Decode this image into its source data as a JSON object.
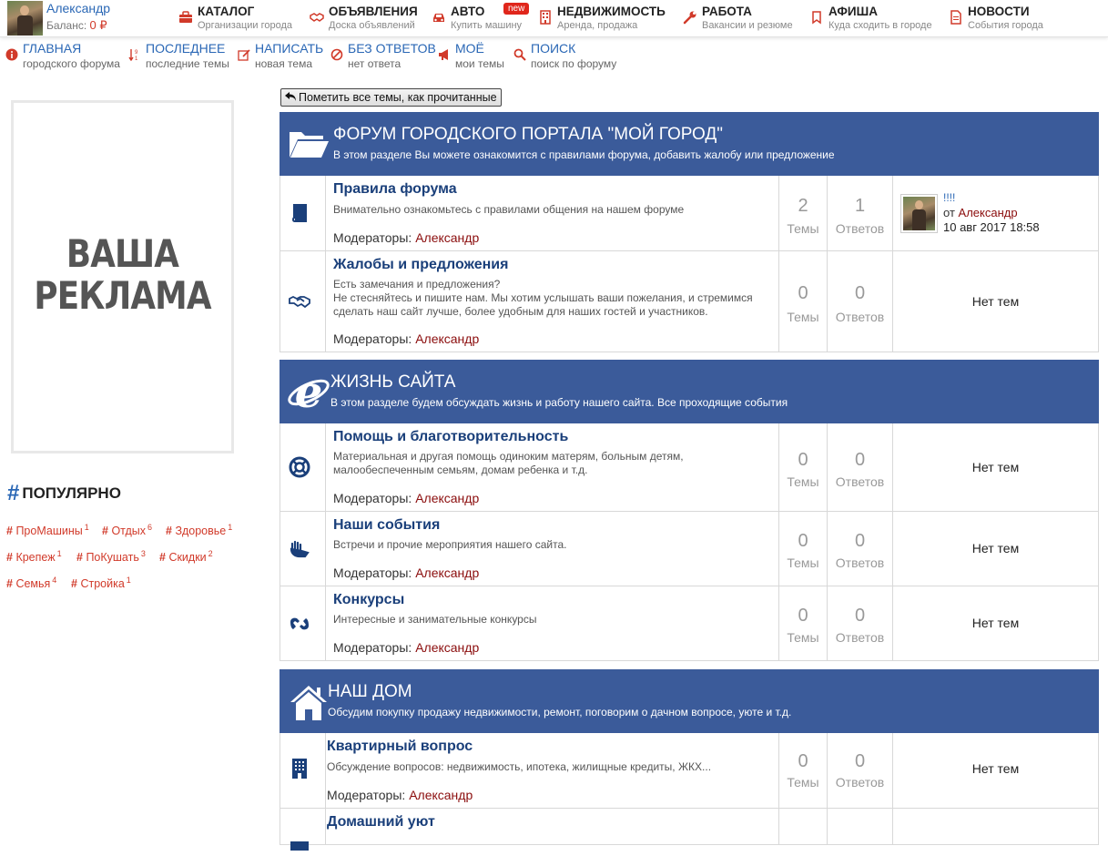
{
  "user": {
    "name": "Александр",
    "balance_label": "Баланс:",
    "balance_value": "0 ₽"
  },
  "mainnav": [
    {
      "title": "КАТАЛОГ",
      "sub": "Организации города",
      "icon": "briefcase-icon"
    },
    {
      "title": "ОБЪЯВЛЕНИЯ",
      "sub": "Доска объявлений",
      "icon": "handshake-icon"
    },
    {
      "title": "АВТО",
      "sub": "Купить машину",
      "icon": "car-icon",
      "badge": "new"
    },
    {
      "title": "НЕДВИЖИМОСТЬ",
      "sub": "Аренда, продажа",
      "icon": "building-icon"
    },
    {
      "title": "РАБОТА",
      "sub": "Вакансии и резюме",
      "icon": "wrench-icon"
    },
    {
      "title": "АФИША",
      "sub": "Куда сходить в городе",
      "icon": "bookmark-icon"
    },
    {
      "title": "НОВОСТИ",
      "sub": "События города",
      "icon": "document-icon"
    }
  ],
  "forumnav": [
    {
      "title": "Главная",
      "sub": "городского форума",
      "icon": "info-icon"
    },
    {
      "title": "Последнее",
      "sub": "последние темы",
      "icon": "sort-icon"
    },
    {
      "title": "Написать",
      "sub": "новая тема",
      "icon": "edit-icon"
    },
    {
      "title": "Без ответов",
      "sub": "нет ответа",
      "icon": "ban-icon"
    },
    {
      "title": "Моё",
      "sub": "мои темы",
      "icon": "megaphone-icon"
    },
    {
      "title": "Поиск",
      "sub": "поиск по форуму",
      "icon": "search-icon"
    }
  ],
  "ad": {
    "line1": "ВАША",
    "line2": "РЕКЛАМА"
  },
  "popular": {
    "title": "ПОПУЛЯРНО",
    "tags": [
      {
        "label": "ПроМашины",
        "count": "1"
      },
      {
        "label": "Отдых",
        "count": "6"
      },
      {
        "label": "Здоровье",
        "count": "1"
      },
      {
        "label": "Крепеж",
        "count": "1"
      },
      {
        "label": "ПоКушать",
        "count": "3"
      },
      {
        "label": "Скидки",
        "count": "2"
      },
      {
        "label": "Семья",
        "count": "4"
      },
      {
        "label": "Стройка",
        "count": "1"
      }
    ]
  },
  "mark_all_read": "Пометить все темы, как прочитанные",
  "labels": {
    "themes": "Темы",
    "answers": "Ответов",
    "moderators": "Модераторы:",
    "no_themes": "Нет тем",
    "by": "от"
  },
  "categories": [
    {
      "title": "Форум городского портала \"Мой город\"",
      "desc": "В этом разделе Вы можете ознакомится с правилами форума, добавить жалобу или предложение",
      "icon": "folder-open-icon",
      "forums": [
        {
          "title": "Правила форума",
          "desc": "Внимательно ознакомьтесь с правилами общения на нашем форуме",
          "moderator": "Александр",
          "themes": "2",
          "answers": "1",
          "icon": "book-icon",
          "last": {
            "title": "!!!!",
            "user": "Александр",
            "date": "10 авг 2017 18:58"
          }
        },
        {
          "title": "Жалобы и предложения",
          "desc": "Есть замечания и предложения?\nНе стесняйтесь и пишите нам. Мы хотим услышать ваши пожелания, и стремимся сделать наш сайт лучше, более удобным для наших гостей и участников.",
          "moderator": "Александр",
          "themes": "0",
          "answers": "0",
          "icon": "handshake-icon"
        }
      ]
    },
    {
      "title": "Жизнь сайта",
      "desc": "В этом разделе будем обсуждать жизнь и работу нашего сайта. Все проходящие события",
      "icon": "internet-explorer-icon",
      "forums": [
        {
          "title": "Помощь и благотворительность",
          "desc": "Материальная и другая помощь одиноким матерям, больным детям, малообеспеченным семьям, домам ребенка и т.д.",
          "moderator": "Александр",
          "themes": "0",
          "answers": "0",
          "icon": "lifebuoy-icon"
        },
        {
          "title": "Наши события",
          "desc": "Встречи и прочие мероприятия нашего сайта.",
          "moderator": "Александр",
          "themes": "0",
          "answers": "0",
          "icon": "sign-language-icon"
        },
        {
          "title": "Конкурсы",
          "desc": "Интересные и занимательные конкурсы",
          "moderator": "Александр",
          "themes": "0",
          "answers": "0",
          "icon": "asl-interpreting-icon"
        }
      ]
    },
    {
      "title": "Наш дом",
      "desc": "Обсудим покупку продажу недвижимости, ремонт, поговорим о дачном вопросе, уюте и т.д.",
      "icon": "home-icon",
      "forums": [
        {
          "title": "Квартирный вопрос",
          "desc": "Обсуждение вопросов: недвижимость, ипотека, жилищные кредиты, ЖКХ...",
          "moderator": "Александр",
          "themes": "0",
          "answers": "0",
          "icon": "building-icon"
        },
        {
          "title": "Домашний уют",
          "icon": "couch-icon"
        }
      ]
    }
  ],
  "colors": {
    "accent_blue": "#3b5b9a",
    "link_blue": "#2a67b5",
    "tag_red": "#d13a2a",
    "moderator_red": "#8b0d0d"
  }
}
